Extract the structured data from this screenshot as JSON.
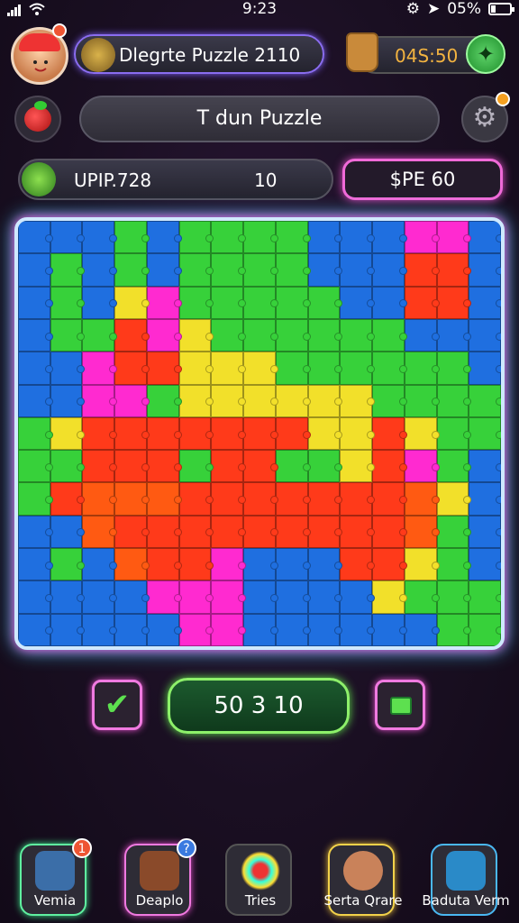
{
  "status_bar": {
    "time": "9:23",
    "battery": "05%"
  },
  "header": {
    "title": "Dlegrte Puzzle 2110",
    "timer": "04S:50"
  },
  "game": {
    "title": "T dun Puzzle",
    "stat_label": "UPIP.728",
    "stat_value": "10",
    "price": "$PE 60",
    "score": "50 3 10"
  },
  "board": {
    "cols": 15,
    "rows": 13,
    "palette": {
      "B": "#1f6fe0",
      "G": "#37d13a",
      "Y": "#f2e02a",
      "R": "#ff3a1a",
      "O": "#ff5a12",
      "P": "#ff2ad0",
      "M": "#f03aa8"
    },
    "layout": [
      "BBBGBGGGGBBBPPB",
      "BGBGBGGGGBBBRRB",
      "BGBYPGGGGGBBRRB",
      "BGGRPYGGGGGGBBB",
      "BBPRRYYYGGGGGGB",
      "BBPPGYYYYYYGGGG",
      "GYRRRRRRRYYRYGG",
      "GGRRRGRRGGYRPGB",
      "GROOORRRRRRROYB",
      "BBORRRRRRRRROGB",
      "BGBORRPBBBRRYGB",
      "BBBBPPPBBBBYGGG",
      "BBBBBPPBBBBBBGG"
    ]
  },
  "nav": [
    {
      "label": "Vemia",
      "badge": "1"
    },
    {
      "label": "Deaplo",
      "badge": "?"
    },
    {
      "label": "Tries"
    },
    {
      "label": "Serta Qrare"
    },
    {
      "label": "Baduta Verm"
    }
  ],
  "colors": {
    "accent_pink": "#f06ad8",
    "accent_green": "#8df06a",
    "accent_purple": "#8a6df0"
  }
}
